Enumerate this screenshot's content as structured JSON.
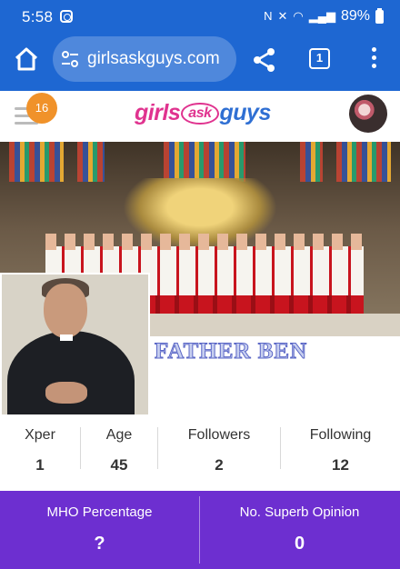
{
  "status_bar": {
    "time": "5:58",
    "battery": "89%"
  },
  "browser": {
    "url": "girlsaskguys.com",
    "tab_count": "1"
  },
  "site": {
    "logo": {
      "part1": "girls",
      "part2": "ask",
      "part3": "guys"
    },
    "notification_count": "16"
  },
  "profile": {
    "name": "FATHER BEN"
  },
  "stats": [
    {
      "label": "Xper",
      "value": "1"
    },
    {
      "label": "Age",
      "value": "45"
    },
    {
      "label": "Followers",
      "value": "2"
    },
    {
      "label": "Following",
      "value": "12"
    }
  ],
  "metrics": [
    {
      "label": "MHO Percentage",
      "value": "?"
    },
    {
      "label": "No. Superb Opinion",
      "value": "0"
    }
  ],
  "colors": {
    "chrome": "#1e67d2",
    "badge": "#f0922a",
    "band": "#6d2fd0",
    "logo_pink": "#e0338f",
    "logo_blue": "#2f6fd3"
  }
}
